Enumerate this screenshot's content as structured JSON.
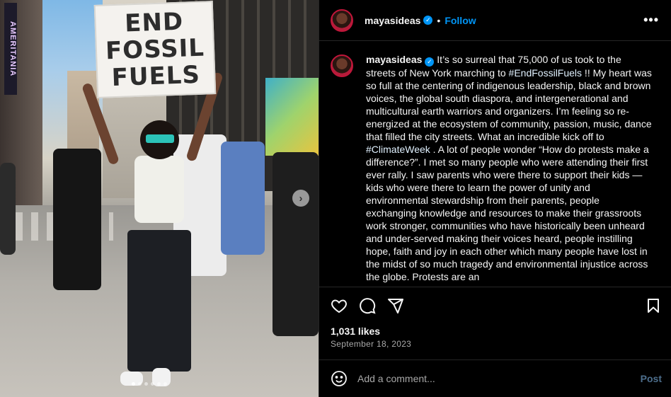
{
  "photo": {
    "sign_lines": [
      "END",
      "FOSSIL",
      "FUELS"
    ],
    "building_sign": "AMERITANIA",
    "next_icon": "chevron-right-icon",
    "carousel_dots": 6,
    "carousel_active": 1
  },
  "header": {
    "username": "mayasideas",
    "separator": "•",
    "follow_label": "Follow",
    "more_icon": "•••"
  },
  "caption": {
    "username": "mayasideas",
    "segments": [
      {
        "t": "It’s so surreal that 75,000 of us took to the streets of New York marching to "
      },
      {
        "t": "#EndFossilFuels",
        "tag": true
      },
      {
        "t": " !! My heart was so full at the centering of indigenous leadership, black and brown voices, the global south diaspora, and intergenerational and multicultural earth warriors and organizers. I’m feeling so re-energized at the ecosystem of community, passion, music, dance that filled the city streets. What an incredible kick off to "
      },
      {
        "t": "#ClimateWeek",
        "tag": true
      },
      {
        "t": " . A lot of people wonder “How do protests make a difference?”. I met so many people who were attending their first ever rally. I saw parents who were there to support their kids — kids who were there to learn the power of unity and environmental stewardship from their parents, people exchanging knowledge and resources to make their grassroots work stronger, communities who have historically been unheard and under-served making their voices heard, people instilling hope, faith and joy in each other which many people have lost in the midst of so much tragedy and environmental injustice across the globe. Protests are an"
      }
    ]
  },
  "actions": {
    "likes": "1,031 likes",
    "date": "September 18, 2023"
  },
  "comment": {
    "placeholder": "Add a comment...",
    "post_label": "Post"
  },
  "colors": {
    "accent": "#0095f6",
    "post_disabled": "#4d6e8c",
    "background": "#000000"
  }
}
